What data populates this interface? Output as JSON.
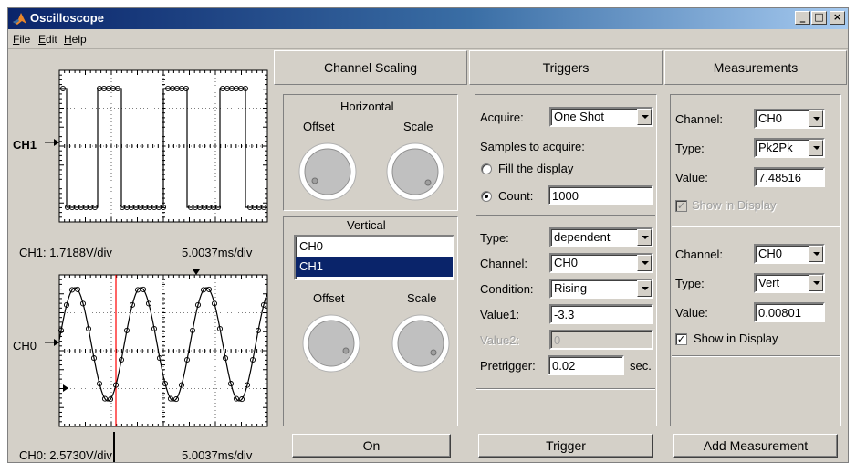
{
  "window": {
    "title": "Oscilloscope",
    "controls": [
      "_",
      "□",
      "×"
    ]
  },
  "menu": [
    "File",
    "Edit",
    "Help"
  ],
  "scope": {
    "ch1": {
      "name": "CH1",
      "scale_label": "CH1: 1.7188V/div",
      "time_label": "5.0037ms/div"
    },
    "ch0": {
      "name": "CH0",
      "scale_label": "CH0: 2.5730V/div",
      "time_label": "5.0037ms/div"
    }
  },
  "tabs": {
    "channel_scaling": "Channel Scaling",
    "triggers": "Triggers",
    "measurements": "Measurements"
  },
  "channel_scaling": {
    "horizontal": {
      "title": "Horizontal",
      "offset": "Offset",
      "scale": "Scale"
    },
    "vertical": {
      "title": "Vertical",
      "offset": "Offset",
      "scale": "Scale"
    },
    "channels": [
      "CH0",
      "CH1"
    ],
    "selected_channel": "CH1",
    "on_button": "On"
  },
  "triggers": {
    "acquire_label": "Acquire:",
    "acquire_value": "One Shot",
    "samples_label": "Samples to acquire:",
    "fill_display": "Fill the display",
    "count_label": "Count:",
    "count_value": "1000",
    "type_label": "Type:",
    "type_value": "dependent",
    "channel_label": "Channel:",
    "channel_value": "CH0",
    "condition_label": "Condition:",
    "condition_value": "Rising",
    "value1_label": "Value1:",
    "value1": "-3.3",
    "value2_label": "Value2:",
    "value2": "0",
    "pretrigger_label": "Pretrigger:",
    "pretrigger_value": "0.02",
    "pretrigger_unit": "sec.",
    "trigger_button": "Trigger"
  },
  "measurements": {
    "m1": {
      "channel_label": "Channel:",
      "channel": "CH0",
      "type_label": "Type:",
      "type": "Pk2Pk",
      "value_label": "Value:",
      "value": "7.48516",
      "show_label": "Show in Display",
      "show_checked": true,
      "show_enabled": false
    },
    "m2": {
      "channel_label": "Channel:",
      "channel": "CH0",
      "type_label": "Type:",
      "type": "Vert",
      "value_label": "Value:",
      "value": "0.00801",
      "show_label": "Show in Display",
      "show_checked": true,
      "show_enabled": true
    },
    "add_button": "Add Measurement"
  },
  "colors": {
    "titlebar": "#0a246a",
    "selection": "#0a246a",
    "cursor": "#ff0000",
    "face": "#d4d0c8"
  }
}
